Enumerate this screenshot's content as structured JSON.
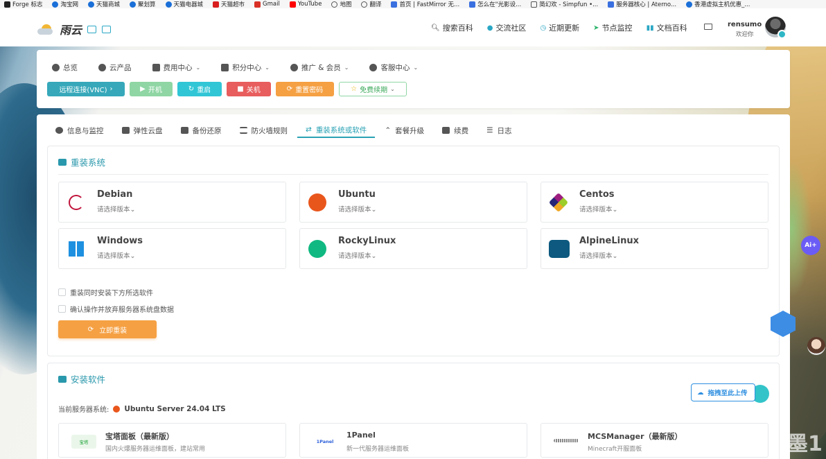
{
  "bookmarks": [
    {
      "label": "Forge 标志",
      "color": "#222222"
    },
    {
      "label": "淘宝网",
      "color": "#1a6fd8"
    },
    {
      "label": "天猫商城",
      "color": "#1a6fd8"
    },
    {
      "label": "聚划算",
      "color": "#1a6fd8"
    },
    {
      "label": "天猫电器城",
      "color": "#1a6fd8"
    },
    {
      "label": "天猫超市",
      "color": "#d81e1e"
    },
    {
      "label": "Gmail",
      "color": "#d93025"
    },
    {
      "label": "YouTube",
      "color": "#ff0000"
    },
    {
      "label": "地图",
      "color": "#555555"
    },
    {
      "label": "翻译",
      "color": "#555555"
    },
    {
      "label": "首页 | FastMirror 无...",
      "color": "#3a6fe0"
    },
    {
      "label": "怎么在\"光影设...",
      "color": "#3a6fe0"
    },
    {
      "label": "简幻欢 - Simpfun •...",
      "color": "#555555"
    },
    {
      "label": "服务器核心 | Aterno...",
      "color": "#3a6fe0"
    },
    {
      "label": "香港虚拟主机优惠_...",
      "color": "#1a6fd8"
    }
  ],
  "header": {
    "logo_text": "雨云",
    "nav": [
      {
        "label": "搜索百科",
        "icon": "search-icon"
      },
      {
        "label": "交流社区",
        "icon": "community-icon"
      },
      {
        "label": "近期更新",
        "icon": "clock-icon"
      },
      {
        "label": "节点监控",
        "icon": "send-icon"
      },
      {
        "label": "文档百科",
        "icon": "book-icon"
      }
    ],
    "user_name": "rensumo",
    "user_welcome": "欢迎你"
  },
  "menu": [
    {
      "label": "总览",
      "caret": false
    },
    {
      "label": "云产品",
      "caret": false
    },
    {
      "label": "费用中心",
      "caret": true
    },
    {
      "label": "积分中心",
      "caret": true
    },
    {
      "label": "推广 & 会员",
      "caret": true
    },
    {
      "label": "客服中心",
      "caret": true
    }
  ],
  "actions": {
    "vnc": "远程连接(VNC)",
    "start": "开机",
    "restart": "重启",
    "stop": "关机",
    "reset_password": "重置密码",
    "renew": "免费续期"
  },
  "tabs": [
    {
      "label": "信息与监控",
      "active": false
    },
    {
      "label": "弹性云盘",
      "active": false
    },
    {
      "label": "备份还原",
      "active": false
    },
    {
      "label": "防火墙规则",
      "active": false
    },
    {
      "label": "重装系统或软件",
      "active": true
    },
    {
      "label": "套餐升级",
      "active": false
    },
    {
      "label": "续费",
      "active": false
    },
    {
      "label": "日志",
      "active": false
    }
  ],
  "reinstall": {
    "title": "重装系统",
    "os_options": [
      {
        "name": "Debian",
        "select": "请选择版本"
      },
      {
        "name": "Ubuntu",
        "select": "请选择版本"
      },
      {
        "name": "Centos",
        "select": "请选择版本"
      },
      {
        "name": "Windows",
        "select": "请选择版本"
      },
      {
        "name": "RockyLinux",
        "select": "请选择版本"
      },
      {
        "name": "AlpineLinux",
        "select": "请选择版本"
      }
    ],
    "check_install_software": "重装同时安装下方所选软件",
    "check_confirm": "确认操作并放弃服务器系统盘数据",
    "install_button": "立即重装"
  },
  "software": {
    "title": "安装软件",
    "current_label": "当前服务器系统:",
    "current_value": "Ubuntu Server 24.04 LTS",
    "items": [
      {
        "name": "宝塔面板（最新版）",
        "desc": "国内火爆服务器运维面板，建站常用",
        "logo_text": "宝塔"
      },
      {
        "name": "1Panel",
        "desc": "新一代服务器运维面板",
        "logo_text": "1Panel"
      },
      {
        "name": "MCSManager（最新版）",
        "desc": "Minecraft开服面板",
        "logo_text": ""
      }
    ]
  },
  "widgets": {
    "upload_label": "拖拽至此上传",
    "ai_label": "Ai+",
    "watermark": "墨1"
  }
}
